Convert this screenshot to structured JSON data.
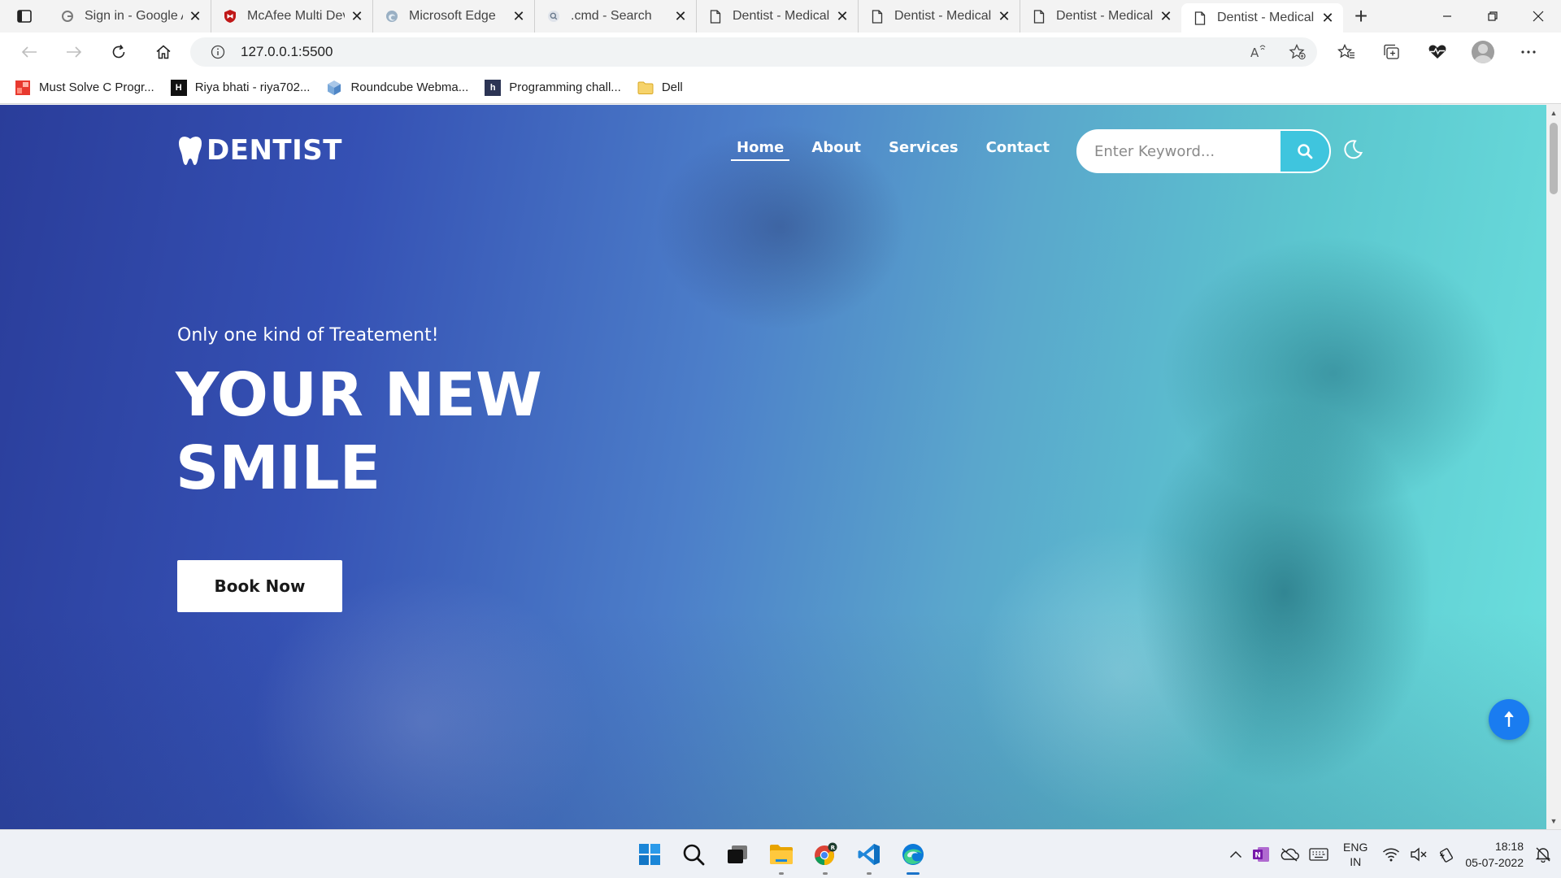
{
  "browser": {
    "tabs": [
      {
        "title": "Sign in - Google A",
        "icon": "google-icon"
      },
      {
        "title": "McAfee Multi Dev",
        "icon": "mcafee-icon"
      },
      {
        "title": "Microsoft Edge",
        "icon": "edge-icon"
      },
      {
        "title": ".cmd - Search",
        "icon": "search-icon"
      },
      {
        "title": "Dentist - Medical",
        "icon": "page-icon"
      },
      {
        "title": "Dentist - Medical",
        "icon": "page-icon"
      },
      {
        "title": "Dentist - Medical",
        "icon": "page-icon"
      },
      {
        "title": "Dentist - Medical",
        "icon": "page-icon",
        "active": true
      }
    ],
    "address": "127.0.0.1:5500",
    "favorites": [
      {
        "label": "Must Solve C Progr...",
        "icon": "must-solve-icon"
      },
      {
        "label": "Riya bhati - riya702...",
        "icon": "hackerrank-icon"
      },
      {
        "label": "Roundcube Webma...",
        "icon": "roundcube-icon"
      },
      {
        "label": "Programming chall...",
        "icon": "hackerearth-icon"
      },
      {
        "label": "Dell",
        "icon": "folder-icon"
      }
    ]
  },
  "site": {
    "logo_text": "DENTIST",
    "nav": [
      {
        "label": "Home",
        "active": true
      },
      {
        "label": "About"
      },
      {
        "label": "Services"
      },
      {
        "label": "Contact"
      }
    ],
    "search_placeholder": "Enter Keyword...",
    "tagline": "Only one kind of Treatement!",
    "headline_line1": "YOUR NEW",
    "headline_line2": "SMILE",
    "cta_label": "Book Now",
    "colors": {
      "hero_left": "#2a3d9a",
      "hero_right": "#6be0de",
      "search_button": "#3fc5de",
      "scroll_top_button": "#1a7cf0"
    }
  },
  "taskbar": {
    "apps": [
      "windows-start-icon",
      "search-icon",
      "task-view-icon",
      "file-explorer-icon",
      "chrome-icon",
      "vscode-icon",
      "edge-icon"
    ],
    "language": "ENG",
    "region": "IN",
    "time": "18:18",
    "date": "05-07-2022"
  }
}
